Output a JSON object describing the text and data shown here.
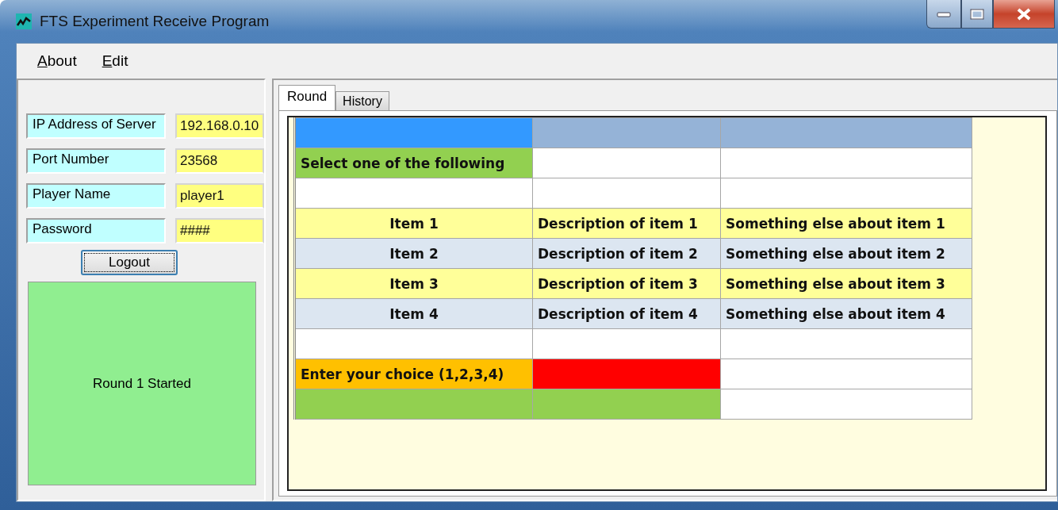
{
  "window": {
    "title": "FTS Experiment Receive Program"
  },
  "menu": [
    {
      "label": "About"
    },
    {
      "label": "Edit"
    }
  ],
  "login": {
    "fields": [
      {
        "label": "IP Address of Server",
        "value": "192.168.0.10"
      },
      {
        "label": "Port Number",
        "value": "23568"
      },
      {
        "label": "Player Name",
        "value": "player1"
      },
      {
        "label": "Password",
        "value": "####"
      }
    ],
    "button": "Logout",
    "status": "Round 1 Started"
  },
  "tabs": [
    {
      "label": "Round",
      "selected": true
    },
    {
      "label": "History",
      "selected": false
    }
  ],
  "grid": {
    "rows": [
      {
        "cells": [
          {
            "color": "#3399ff"
          },
          {
            "color": "#95b3d7"
          },
          {
            "color": "#95b3d7"
          }
        ]
      },
      {
        "cells": [
          {
            "text": "Select one of the following",
            "color": "#92d050"
          },
          {
            "color": "#ffffff"
          },
          {
            "color": "#ffffff"
          }
        ]
      },
      {
        "cells": [
          {
            "color": "#ffffff"
          },
          {
            "color": "#ffffff"
          },
          {
            "color": "#ffffff"
          }
        ]
      },
      {
        "cells": [
          {
            "text": "Item 1",
            "color": "#ffff99",
            "center": true
          },
          {
            "text": "Description of item 1",
            "color": "#ffff99"
          },
          {
            "text": "Something else about item 1",
            "color": "#ffff99"
          }
        ]
      },
      {
        "cells": [
          {
            "text": "Item 2",
            "color": "#dce6f1",
            "center": true
          },
          {
            "text": "Description of item 2",
            "color": "#dce6f1"
          },
          {
            "text": "Something else about item 2",
            "color": "#dce6f1"
          }
        ]
      },
      {
        "cells": [
          {
            "text": "Item 3",
            "color": "#ffff99",
            "center": true
          },
          {
            "text": "Description of item 3",
            "color": "#ffff99"
          },
          {
            "text": "Something else about item 3",
            "color": "#ffff99"
          }
        ]
      },
      {
        "cells": [
          {
            "text": "Item 4",
            "color": "#dce6f1",
            "center": true
          },
          {
            "text": "Description of item 4",
            "color": "#dce6f1"
          },
          {
            "text": "Something else about item 4",
            "color": "#dce6f1"
          }
        ]
      },
      {
        "cells": [
          {
            "color": "#ffffff"
          },
          {
            "color": "#ffffff"
          },
          {
            "color": "#ffffff"
          }
        ]
      },
      {
        "cells": [
          {
            "text": "Enter your choice (1,2,3,4)",
            "color": "#ffc000"
          },
          {
            "color": "#ff0000"
          },
          {
            "color": "#ffffff"
          }
        ]
      },
      {
        "cells": [
          {
            "color": "#92d050"
          },
          {
            "color": "#92d050"
          },
          {
            "color": "#ffffff"
          }
        ]
      }
    ]
  }
}
